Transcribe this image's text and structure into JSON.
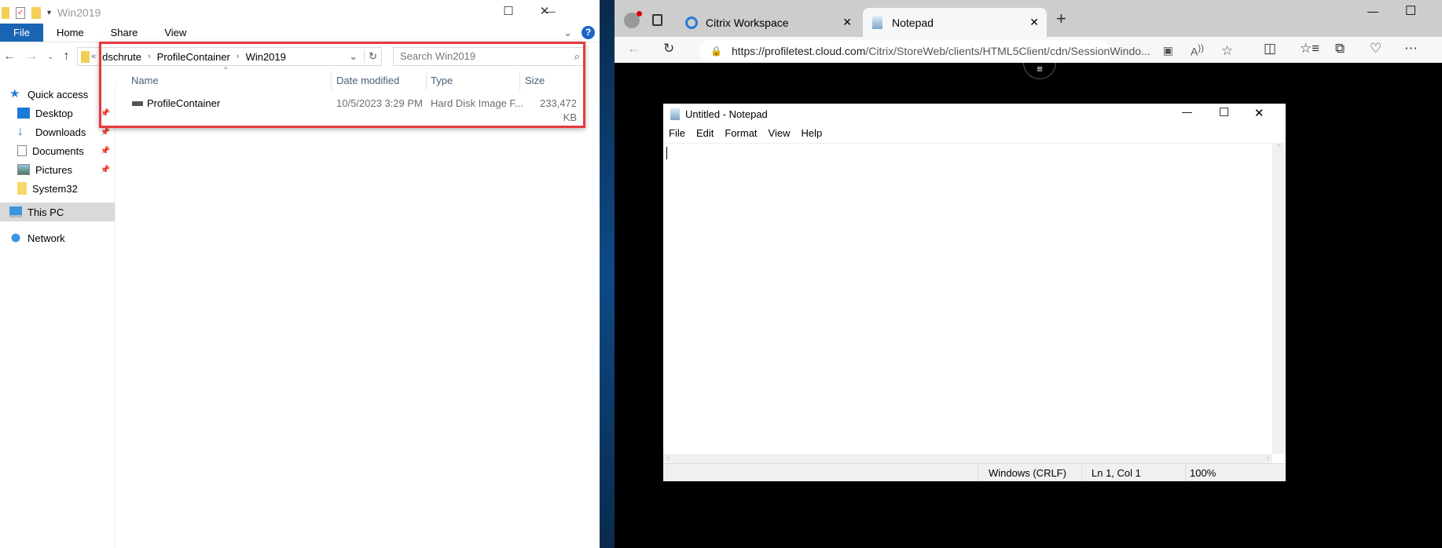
{
  "explorer": {
    "title": "Win2019",
    "ribbon_tabs": [
      "File",
      "Home",
      "Share",
      "View"
    ],
    "breadcrumb": [
      "dschrute",
      "ProfileContainer",
      "Win2019"
    ],
    "search_placeholder": "Search Win2019",
    "columns": {
      "name": "Name",
      "date": "Date modified",
      "type": "Type",
      "size": "Size"
    },
    "files": [
      {
        "name": "ProfileContainer",
        "date": "10/5/2023 3:29 PM",
        "type": "Hard Disk Image F...",
        "size": "233,472 KB"
      }
    ],
    "sidebar": [
      {
        "label": "Quick access",
        "icon": "star-icon"
      },
      {
        "label": "Desktop",
        "icon": "desktop-icon",
        "pinned": true
      },
      {
        "label": "Downloads",
        "icon": "download-icon",
        "pinned": true
      },
      {
        "label": "Documents",
        "icon": "documents-icon",
        "pinned": true
      },
      {
        "label": "Pictures",
        "icon": "pictures-icon",
        "pinned": true
      },
      {
        "label": "System32",
        "icon": "folder-icon"
      },
      {
        "label": "This PC",
        "icon": "pc-icon",
        "selected": true
      },
      {
        "label": "Network",
        "icon": "network-icon"
      }
    ]
  },
  "browser": {
    "tabs": [
      {
        "label": "Citrix Workspace"
      },
      {
        "label": "Notepad",
        "active": true
      }
    ],
    "url_host": "https://profiletest.cloud.com",
    "url_path": "/Citrix/StoreWeb/clients/HTML5Client/cdn/SessionWindo..."
  },
  "notepad": {
    "title": "Untitled - Notepad",
    "menu": [
      "File",
      "Edit",
      "Format",
      "View",
      "Help"
    ],
    "status": {
      "line_ending": "Windows (CRLF)",
      "position": "Ln 1, Col 1",
      "zoom": "100%"
    }
  }
}
